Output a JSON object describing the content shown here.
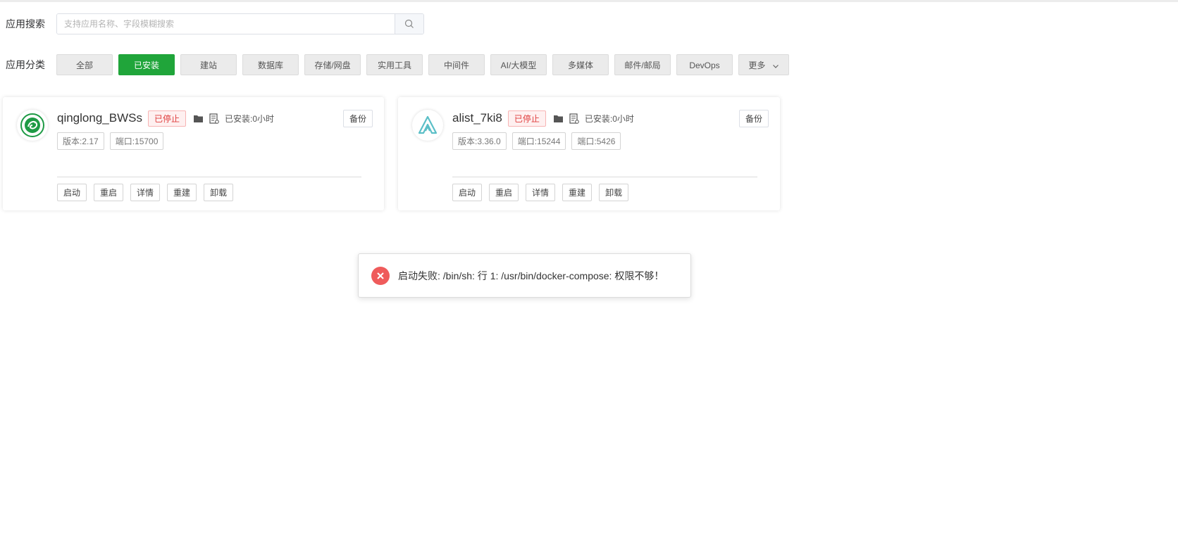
{
  "search": {
    "label": "应用搜索",
    "placeholder": "支持应用名称、字段模糊搜索",
    "value": ""
  },
  "categories": {
    "label": "应用分类",
    "items": [
      "全部",
      "已安装",
      "建站",
      "数据库",
      "存储/网盘",
      "实用工具",
      "中间件",
      "AI/大模型",
      "多媒体",
      "邮件/邮局",
      "DevOps"
    ],
    "active_index": 1,
    "more_label": "更多"
  },
  "apps": [
    {
      "name": "qinglong_BWSs",
      "status": "已停止",
      "installed": "已安装:0小时",
      "backup": "备份",
      "tags": [
        "版本:2.17",
        "端口:15700"
      ],
      "actions": [
        "启动",
        "重启",
        "详情",
        "重建",
        "卸载"
      ],
      "logo": "qinglong-dragon-icon"
    },
    {
      "name": "alist_7ki8",
      "status": "已停止",
      "installed": "已安装:0小时",
      "backup": "备份",
      "tags": [
        "版本:3.36.0",
        "端口:15244",
        "端口:5426"
      ],
      "actions": [
        "启动",
        "重启",
        "详情",
        "重建",
        "卸载"
      ],
      "logo": "alist-triangle-icon"
    }
  ],
  "toast": {
    "message": "启动失败: /bin/sh: 行 1: /usr/bin/docker-compose: 权限不够！",
    "type": "error"
  },
  "colors": {
    "accent": "#20a53a",
    "error": "#ef5b5b",
    "status_text": "#e03c3c"
  }
}
